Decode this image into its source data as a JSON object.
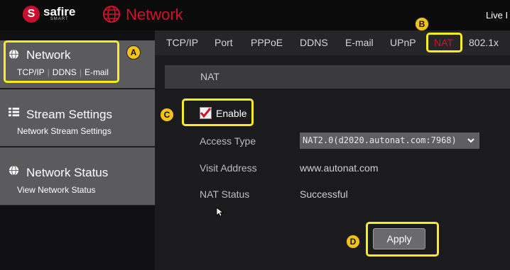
{
  "header": {
    "logo_mark": "S",
    "logo_text": "safire",
    "logo_sub": "SMART",
    "title": "Network",
    "live_label": "Live I"
  },
  "sidebar": {
    "items": [
      {
        "title": "Network",
        "links": [
          "TCP/IP",
          "DDNS",
          "E-mail"
        ],
        "icon": "globe-icon"
      },
      {
        "title": "Stream Settings",
        "subtitle": "Network Stream Settings",
        "icon": "list-icon"
      },
      {
        "title": "Network Status",
        "subtitle": "View Network Status",
        "icon": "globe-icon"
      }
    ]
  },
  "tabs": [
    "TCP/IP",
    "Port",
    "PPPoE",
    "DDNS",
    "E-mail",
    "UPnP",
    "NAT",
    "802.1x"
  ],
  "active_tab": "NAT",
  "nat": {
    "section_title": "NAT",
    "enable_label": "Enable",
    "enabled": true,
    "access_type_label": "Access Type",
    "access_type_value": "NAT2.0(d2020.autonat.com:7968)",
    "visit_address_label": "Visit Address",
    "visit_address_value": "www.autonat.com",
    "nat_status_label": "NAT Status",
    "nat_status_value": "Successful",
    "apply_label": "Apply"
  },
  "annotations": {
    "a": "A",
    "b": "B",
    "c": "C",
    "d": "D"
  },
  "colors": {
    "brand_red": "#d4112c",
    "highlight": "#f6ec1f",
    "marker": "#f2c21a"
  }
}
